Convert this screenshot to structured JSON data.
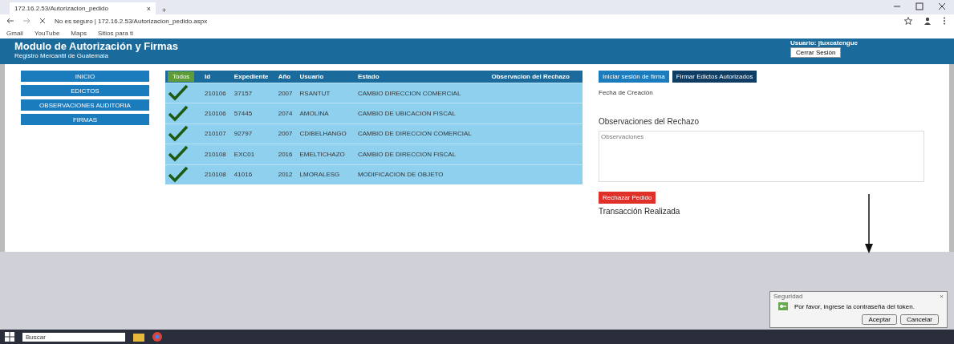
{
  "browser": {
    "tab_title": "172.16.2.53/Autorizacion_pedido",
    "tab_close": "×",
    "new_tab": "+",
    "address": "No es seguro | 172.16.2.53/Autorizacion_pedido.aspx",
    "bookmarks": [
      "Gmail",
      "YouTube",
      "Maps",
      "Sitios para ti"
    ]
  },
  "header": {
    "title": "Modulo de Autorización y Firmas",
    "subtitle": "Registro Mercantil de Guatemala",
    "user": "Usuario: jtuxcatengue",
    "logout": "Cerrar Sesión"
  },
  "sidebar": {
    "items": [
      {
        "label": "INICIO",
        "selected": false
      },
      {
        "label": "EDICTOS",
        "selected": false
      },
      {
        "label": "OBSERVACIONES AUDITORIA",
        "selected": false
      },
      {
        "label": "FIRMAS",
        "selected": false
      }
    ]
  },
  "table": {
    "select_all": "Todos",
    "columns": [
      "Id",
      "Expediente",
      "Año",
      "Usuario",
      "Estado",
      "Observacion del Rechazo"
    ],
    "rows": [
      {
        "checked": true,
        "cells": [
          "210106",
          "37157",
          "2007",
          "RSANTUT",
          "CAMBIO DIRECCION COMERCIAL",
          ""
        ]
      },
      {
        "checked": true,
        "cells": [
          "210106",
          "57445",
          "2074",
          "AMOLINA",
          "CAMBIO DE UBICACION FISCAL",
          ""
        ]
      },
      {
        "checked": true,
        "cells": [
          "210107",
          "92797",
          "2007",
          "CDIBELHANGO",
          "CAMBIO DE DIRECCION COMERCIAL",
          ""
        ]
      },
      {
        "checked": true,
        "cells": [
          "210108",
          "EXC01",
          "2016",
          "EMELTICHAZO",
          "CAMBIO DE DIRECCION FISCAL",
          ""
        ]
      },
      {
        "checked": true,
        "cells": [
          "210108",
          "41016",
          "2012",
          "LMORALESG",
          "MODIFICACION DE OBJETO",
          ""
        ]
      }
    ]
  },
  "actions": {
    "start_button": "Iniciar sesión de firma",
    "sign_button": "Firmar Edictos Autorizados",
    "date_label": "Fecha de Creación",
    "observations_label": "Observaciones del Rechazo",
    "observations_placeholder": "Observaciones",
    "reject_button": "Rechazar Pedido",
    "status": "Transacción Realizada"
  },
  "dialog": {
    "title": "Seguridad",
    "close": "×",
    "message": "Por favor, ingrese la contraseña del token.",
    "buttons": [
      "Aceptar",
      "Cancelar"
    ]
  },
  "taskbar": {
    "search": "Buscar"
  }
}
